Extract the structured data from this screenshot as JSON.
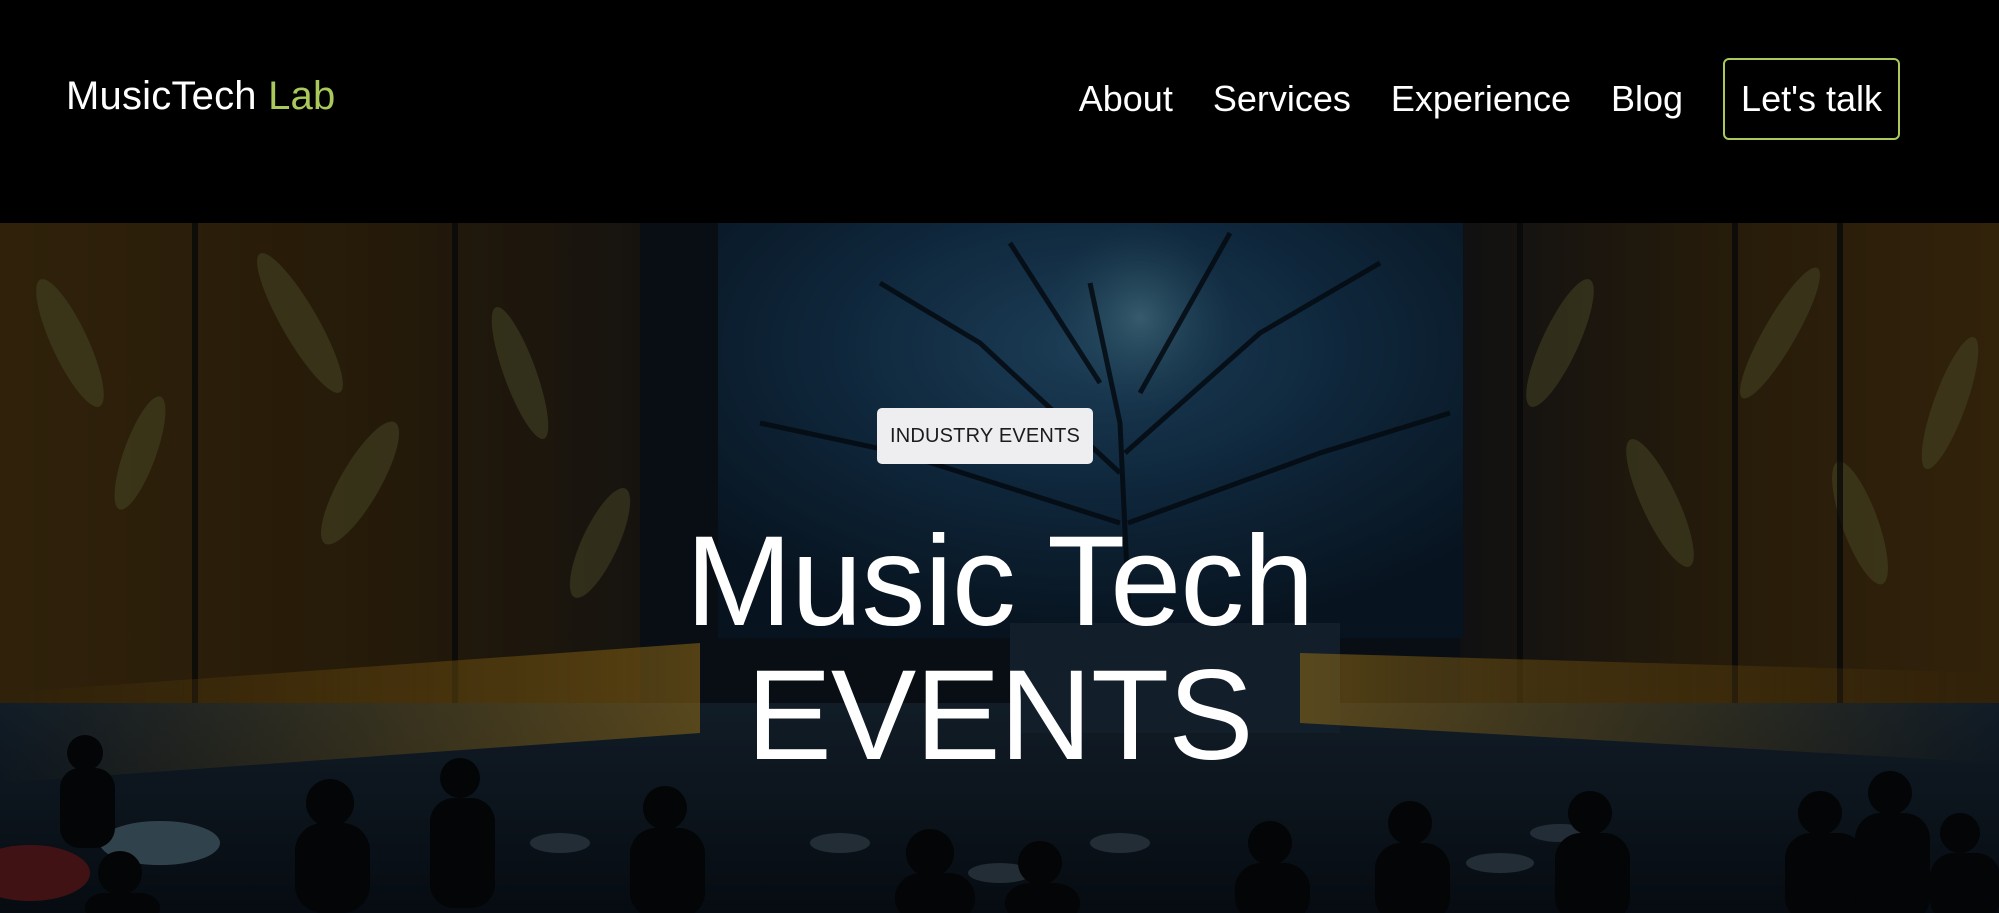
{
  "brand": {
    "name": "MusicTech",
    "accent": "Lab",
    "accent_color": "#a9c95a"
  },
  "nav": {
    "items": [
      {
        "label": "About"
      },
      {
        "label": "Services"
      },
      {
        "label": "Experience"
      },
      {
        "label": "Blog"
      }
    ],
    "cta_label": "Let's talk"
  },
  "hero": {
    "badge": "INDUSTRY EVENTS",
    "title_line1": "Music Tech",
    "title_line2": "EVENTS",
    "background_image": "dark concert hall with projected forest canopy screen, leaf-patterned curtains, stage lights and seated audience silhouettes"
  }
}
